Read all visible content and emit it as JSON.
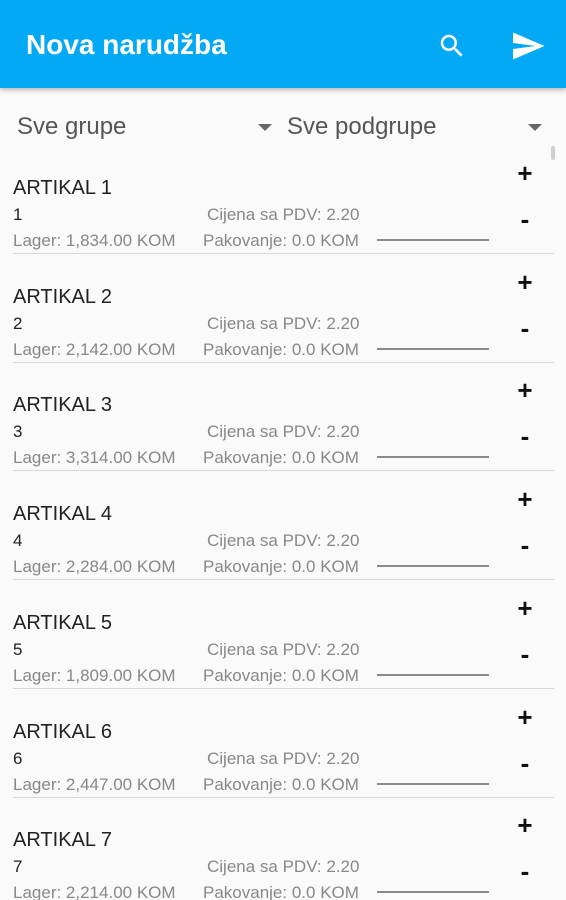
{
  "appbar": {
    "title": "Nova narudžba",
    "search_icon": "search-icon",
    "send_icon": "send-icon",
    "color": "#03A9F4"
  },
  "filters": {
    "groups_selected": "Sve grupe",
    "subgroups_selected": "Sve podgrupe"
  },
  "buttons": {
    "plus_label": "+",
    "minus_label": "-"
  },
  "items": [
    {
      "name": "ARTIKAL 1",
      "code": "1",
      "price": "Cijena sa PDV: 2.20",
      "stock": "Lager: 1,834.00 KOM",
      "pack": "Pakovanje: 0.0 KOM"
    },
    {
      "name": "ARTIKAL 2",
      "code": "2",
      "price": "Cijena sa PDV: 2.20",
      "stock": "Lager: 2,142.00 KOM",
      "pack": "Pakovanje: 0.0 KOM"
    },
    {
      "name": "ARTIKAL 3",
      "code": "3",
      "price": "Cijena sa PDV: 2.20",
      "stock": "Lager: 3,314.00 KOM",
      "pack": "Pakovanje: 0.0 KOM"
    },
    {
      "name": "ARTIKAL 4",
      "code": "4",
      "price": "Cijena sa PDV: 2.20",
      "stock": "Lager: 2,284.00 KOM",
      "pack": "Pakovanje: 0.0 KOM"
    },
    {
      "name": "ARTIKAL 5",
      "code": "5",
      "price": "Cijena sa PDV: 2.20",
      "stock": "Lager: 1,809.00 KOM",
      "pack": "Pakovanje: 0.0 KOM"
    },
    {
      "name": "ARTIKAL 6",
      "code": "6",
      "price": "Cijena sa PDV: 2.20",
      "stock": "Lager: 2,447.00 KOM",
      "pack": "Pakovanje: 0.0 KOM"
    },
    {
      "name": "ARTIKAL 7",
      "code": "7",
      "price": "Cijena sa PDV: 2.20",
      "stock": "Lager: 2,214.00 KOM",
      "pack": "Pakovanje: 0.0 KOM"
    }
  ]
}
